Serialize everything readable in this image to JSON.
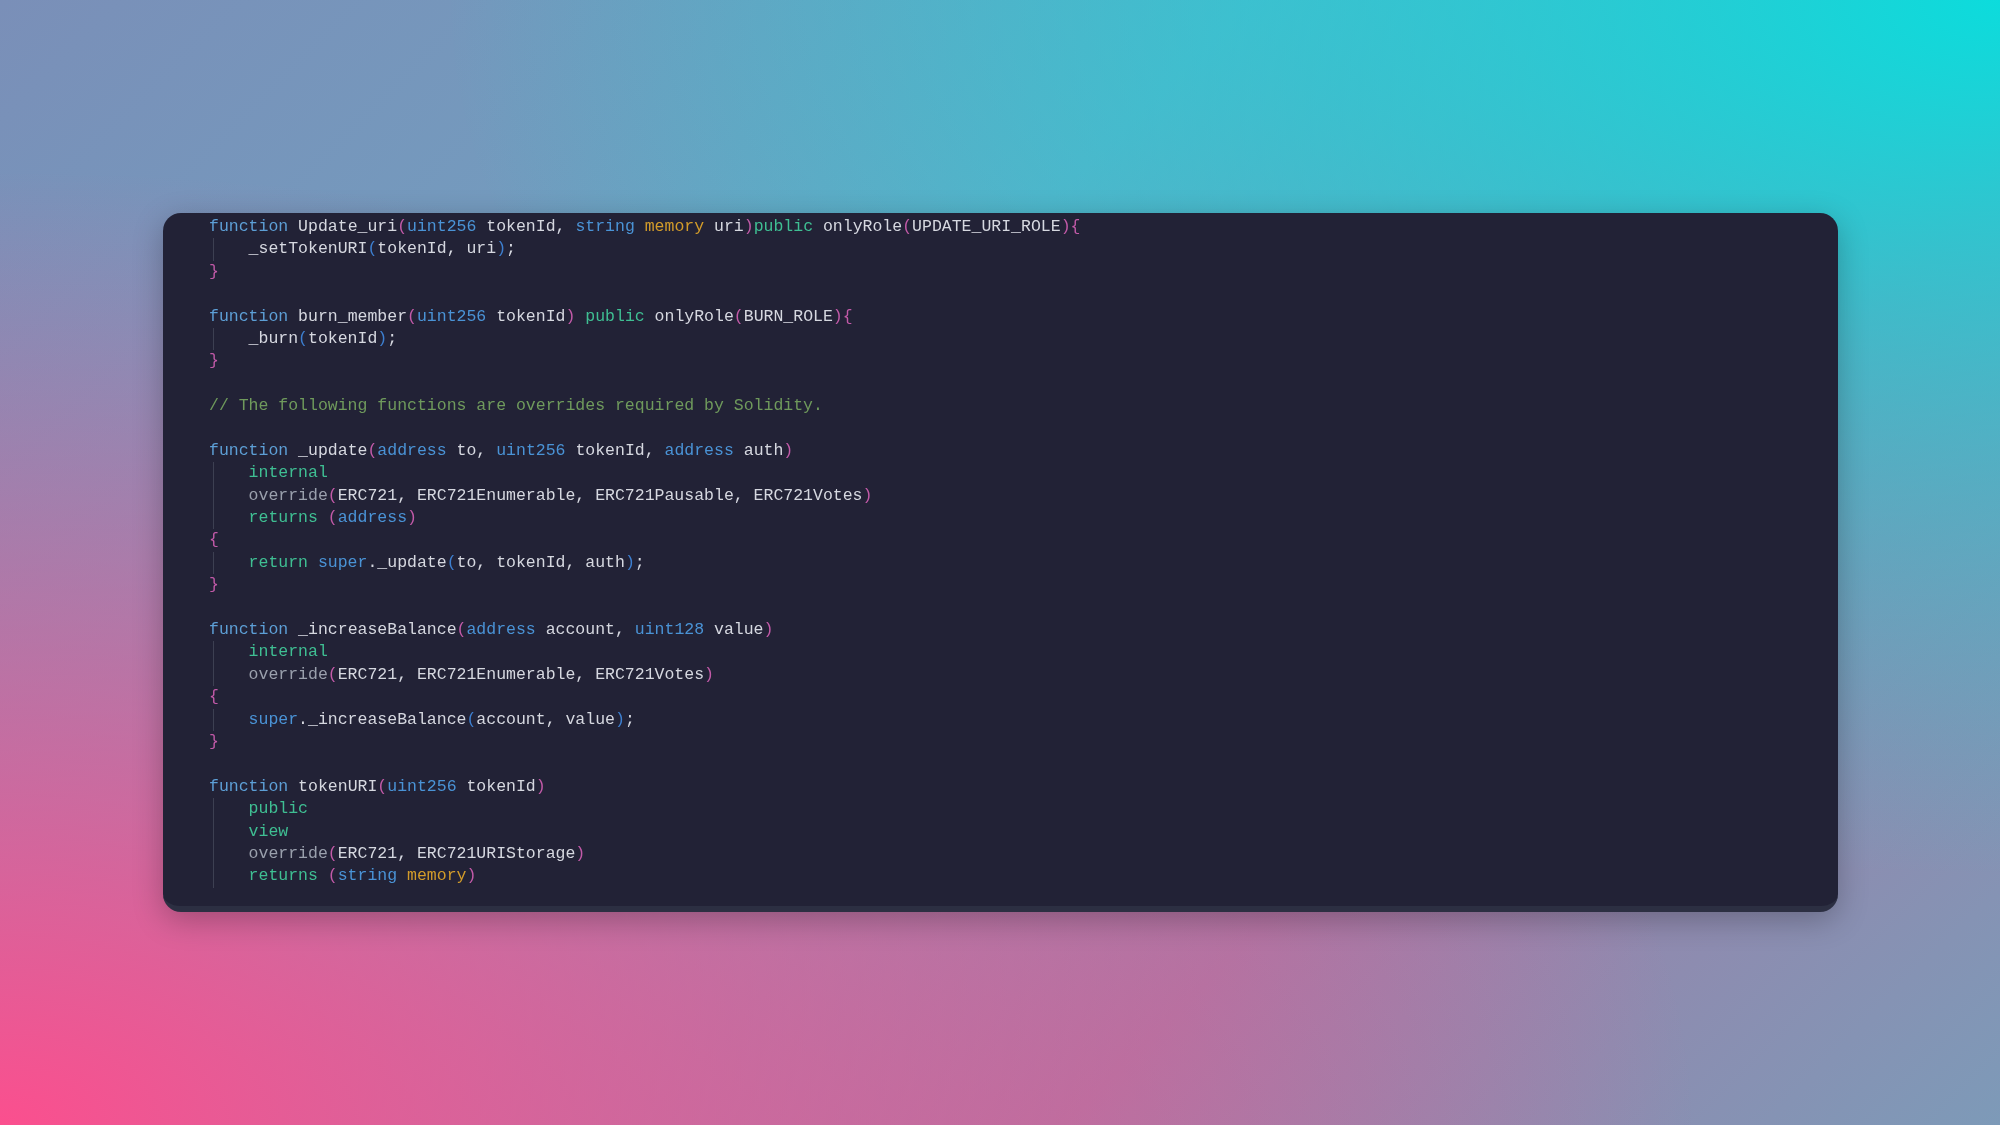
{
  "editor": {
    "lines": [
      {
        "kind": "code",
        "indented": false,
        "tokens": [
          {
            "kind": "keyword",
            "text": "function"
          },
          {
            "kind": "plain",
            "text": " Update_uri"
          },
          {
            "kind": "paren",
            "text": "("
          },
          {
            "kind": "type",
            "text": "uint256"
          },
          {
            "kind": "plain",
            "text": " tokenId, "
          },
          {
            "kind": "type",
            "text": "string"
          },
          {
            "kind": "storage",
            "text": " memory"
          },
          {
            "kind": "plain",
            "text": " uri"
          },
          {
            "kind": "paren",
            "text": ")"
          },
          {
            "kind": "modifier",
            "text": "public"
          },
          {
            "kind": "plain",
            "text": " onlyRole"
          },
          {
            "kind": "paren",
            "text": "("
          },
          {
            "kind": "plain",
            "text": "UPDATE_URI_ROLE"
          },
          {
            "kind": "paren",
            "text": "){"
          }
        ]
      },
      {
        "kind": "code",
        "indented": true,
        "tokens": [
          {
            "kind": "plain",
            "text": "_setTokenURI"
          },
          {
            "kind": "paren2",
            "text": "("
          },
          {
            "kind": "plain",
            "text": "tokenId, uri"
          },
          {
            "kind": "paren2",
            "text": ")"
          },
          {
            "kind": "plain",
            "text": ";"
          }
        ]
      },
      {
        "kind": "code",
        "indented": false,
        "tokens": [
          {
            "kind": "paren",
            "text": "}"
          }
        ]
      },
      {
        "kind": "blank"
      },
      {
        "kind": "code",
        "indented": false,
        "tokens": [
          {
            "kind": "keyword",
            "text": "function"
          },
          {
            "kind": "plain",
            "text": " burn_member"
          },
          {
            "kind": "paren",
            "text": "("
          },
          {
            "kind": "type",
            "text": "uint256"
          },
          {
            "kind": "plain",
            "text": " tokenId"
          },
          {
            "kind": "paren",
            "text": ")"
          },
          {
            "kind": "modifier",
            "text": " public"
          },
          {
            "kind": "plain",
            "text": " onlyRole"
          },
          {
            "kind": "paren",
            "text": "("
          },
          {
            "kind": "plain",
            "text": "BURN_ROLE"
          },
          {
            "kind": "paren",
            "text": "){"
          }
        ]
      },
      {
        "kind": "code",
        "indented": true,
        "tokens": [
          {
            "kind": "plain",
            "text": "_burn"
          },
          {
            "kind": "paren2",
            "text": "("
          },
          {
            "kind": "plain",
            "text": "tokenId"
          },
          {
            "kind": "paren2",
            "text": ")"
          },
          {
            "kind": "plain",
            "text": ";"
          }
        ]
      },
      {
        "kind": "code",
        "indented": false,
        "tokens": [
          {
            "kind": "paren",
            "text": "}"
          }
        ]
      },
      {
        "kind": "blank"
      },
      {
        "kind": "code",
        "indented": false,
        "tokens": [
          {
            "kind": "comment",
            "text": "// The following functions are overrides required by Solidity."
          }
        ]
      },
      {
        "kind": "blank"
      },
      {
        "kind": "code",
        "indented": false,
        "tokens": [
          {
            "kind": "keyword",
            "text": "function"
          },
          {
            "kind": "plain",
            "text": " _update"
          },
          {
            "kind": "paren",
            "text": "("
          },
          {
            "kind": "type",
            "text": "address"
          },
          {
            "kind": "plain",
            "text": " to, "
          },
          {
            "kind": "type",
            "text": "uint256"
          },
          {
            "kind": "plain",
            "text": " tokenId, "
          },
          {
            "kind": "type",
            "text": "address"
          },
          {
            "kind": "plain",
            "text": " auth"
          },
          {
            "kind": "paren",
            "text": ")"
          }
        ]
      },
      {
        "kind": "code",
        "indented": true,
        "tokens": [
          {
            "kind": "modifier",
            "text": "internal"
          }
        ]
      },
      {
        "kind": "code",
        "indented": true,
        "tokens": [
          {
            "kind": "muted",
            "text": "override"
          },
          {
            "kind": "paren",
            "text": "("
          },
          {
            "kind": "plain",
            "text": "ERC721, ERC721Enumerable, ERC721Pausable, ERC721Votes"
          },
          {
            "kind": "paren",
            "text": ")"
          }
        ]
      },
      {
        "kind": "code",
        "indented": true,
        "tokens": [
          {
            "kind": "modifier",
            "text": "returns"
          },
          {
            "kind": "paren",
            "text": " ("
          },
          {
            "kind": "type",
            "text": "address"
          },
          {
            "kind": "paren",
            "text": ")"
          }
        ]
      },
      {
        "kind": "code",
        "indented": false,
        "tokens": [
          {
            "kind": "paren",
            "text": "{"
          }
        ]
      },
      {
        "kind": "code",
        "indented": true,
        "tokens": [
          {
            "kind": "modifier",
            "text": "return"
          },
          {
            "kind": "type",
            "text": " super"
          },
          {
            "kind": "plain",
            "text": "._update"
          },
          {
            "kind": "paren2",
            "text": "("
          },
          {
            "kind": "plain",
            "text": "to, tokenId, auth"
          },
          {
            "kind": "paren2",
            "text": ")"
          },
          {
            "kind": "plain",
            "text": ";"
          }
        ]
      },
      {
        "kind": "code",
        "indented": false,
        "tokens": [
          {
            "kind": "paren",
            "text": "}"
          }
        ]
      },
      {
        "kind": "blank"
      },
      {
        "kind": "code",
        "indented": false,
        "tokens": [
          {
            "kind": "keyword",
            "text": "function"
          },
          {
            "kind": "plain",
            "text": " _increaseBalance"
          },
          {
            "kind": "paren",
            "text": "("
          },
          {
            "kind": "type",
            "text": "address"
          },
          {
            "kind": "plain",
            "text": " account, "
          },
          {
            "kind": "type",
            "text": "uint128"
          },
          {
            "kind": "plain",
            "text": " value"
          },
          {
            "kind": "paren",
            "text": ")"
          }
        ]
      },
      {
        "kind": "code",
        "indented": true,
        "tokens": [
          {
            "kind": "modifier",
            "text": "internal"
          }
        ]
      },
      {
        "kind": "code",
        "indented": true,
        "tokens": [
          {
            "kind": "muted",
            "text": "override"
          },
          {
            "kind": "paren",
            "text": "("
          },
          {
            "kind": "plain",
            "text": "ERC721, ERC721Enumerable, ERC721Votes"
          },
          {
            "kind": "paren",
            "text": ")"
          }
        ]
      },
      {
        "kind": "code",
        "indented": false,
        "tokens": [
          {
            "kind": "paren",
            "text": "{"
          }
        ]
      },
      {
        "kind": "code",
        "indented": true,
        "tokens": [
          {
            "kind": "type",
            "text": "super"
          },
          {
            "kind": "plain",
            "text": "._increaseBalance"
          },
          {
            "kind": "paren2",
            "text": "("
          },
          {
            "kind": "plain",
            "text": "account, value"
          },
          {
            "kind": "paren2",
            "text": ")"
          },
          {
            "kind": "plain",
            "text": ";"
          }
        ]
      },
      {
        "kind": "code",
        "indented": false,
        "tokens": [
          {
            "kind": "paren",
            "text": "}"
          }
        ]
      },
      {
        "kind": "blank"
      },
      {
        "kind": "code",
        "indented": false,
        "tokens": [
          {
            "kind": "keyword",
            "text": "function"
          },
          {
            "kind": "plain",
            "text": " tokenURI"
          },
          {
            "kind": "paren",
            "text": "("
          },
          {
            "kind": "type",
            "text": "uint256"
          },
          {
            "kind": "plain",
            "text": " tokenId"
          },
          {
            "kind": "paren",
            "text": ")"
          }
        ]
      },
      {
        "kind": "code",
        "indented": true,
        "tokens": [
          {
            "kind": "modifier",
            "text": "public"
          }
        ]
      },
      {
        "kind": "code",
        "indented": true,
        "tokens": [
          {
            "kind": "modifier",
            "text": "view"
          }
        ]
      },
      {
        "kind": "code",
        "indented": true,
        "tokens": [
          {
            "kind": "muted",
            "text": "override"
          },
          {
            "kind": "paren",
            "text": "("
          },
          {
            "kind": "plain",
            "text": "ERC721, ERC721URIStorage"
          },
          {
            "kind": "paren",
            "text": ")"
          }
        ]
      },
      {
        "kind": "code",
        "indented": true,
        "tokens": [
          {
            "kind": "modifier",
            "text": "returns"
          },
          {
            "kind": "paren",
            "text": " ("
          },
          {
            "kind": "type",
            "text": "string"
          },
          {
            "kind": "storage",
            "text": " memory"
          },
          {
            "kind": "paren",
            "text": ")"
          }
        ]
      }
    ]
  }
}
